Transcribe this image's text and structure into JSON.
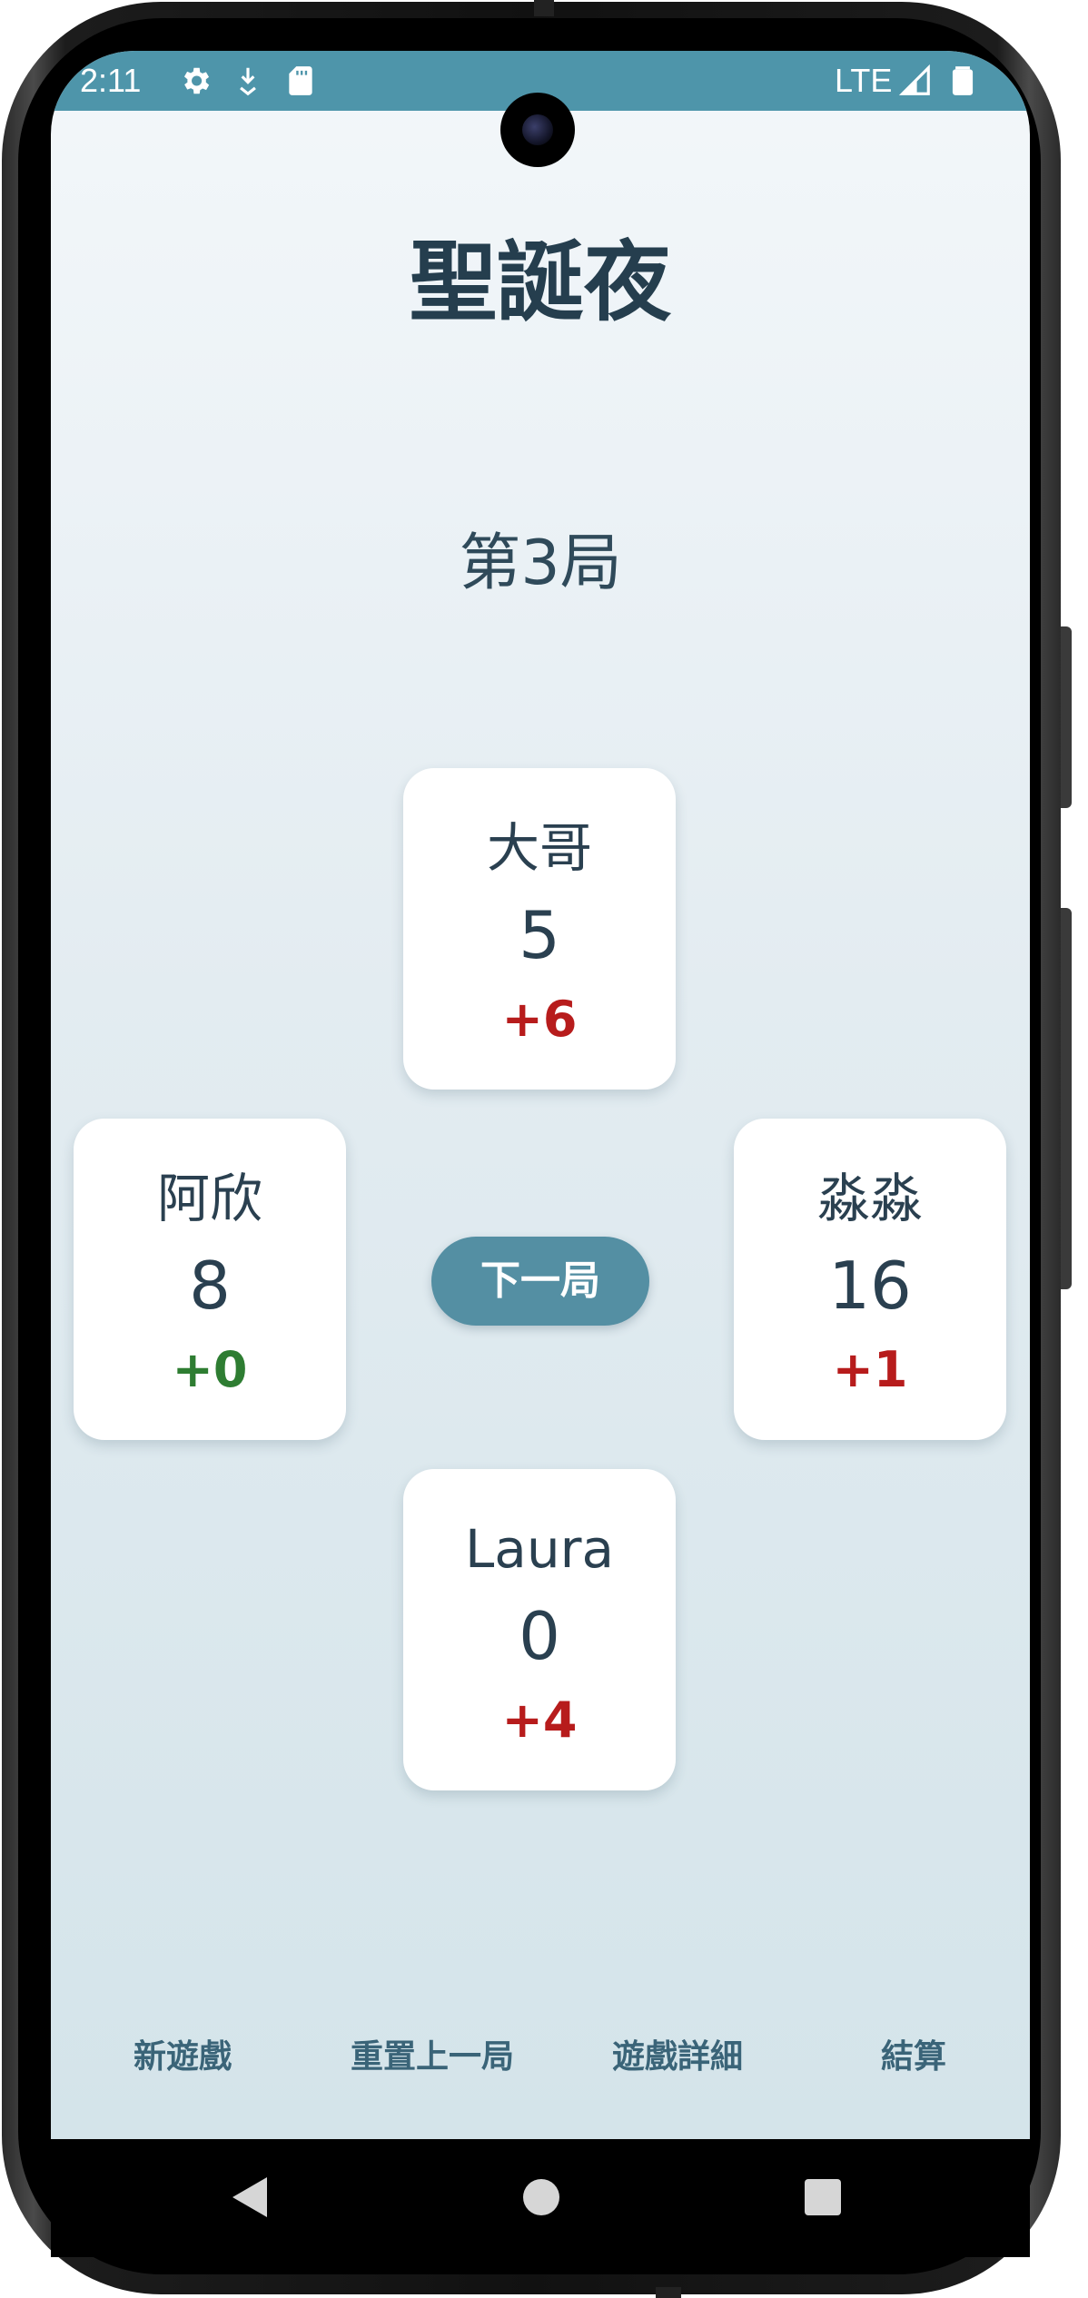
{
  "status_bar": {
    "time": "2:11",
    "network": "LTE",
    "icons": [
      "settings-icon",
      "download-icon",
      "sd-card-icon",
      "signal-icon",
      "battery-icon"
    ]
  },
  "game": {
    "title": "聖誕夜",
    "round_label": "第3局",
    "next_round_label": "下一局"
  },
  "players": {
    "top": {
      "name": "大哥",
      "score": "5",
      "delta": "+6"
    },
    "left": {
      "name": "阿欣",
      "score": "8",
      "delta": "+0"
    },
    "right": {
      "name": "淼淼",
      "score": "16",
      "delta": "+1"
    },
    "bottom": {
      "name": "Laura",
      "score": "0",
      "delta": "+4"
    }
  },
  "actions": {
    "new_game": "新遊戲",
    "reset_last_round": "重置上一局",
    "game_details": "遊戲詳細",
    "settle": "結算"
  },
  "colors": {
    "accent": "#548fa3",
    "status_bar": "#4e95aa",
    "title_text": "#253e4e",
    "positive_delta": "#b71c1c",
    "zero_delta": "#2e7d32"
  },
  "nav_bar": {
    "icons": [
      "back-icon",
      "home-icon",
      "recents-icon"
    ]
  }
}
